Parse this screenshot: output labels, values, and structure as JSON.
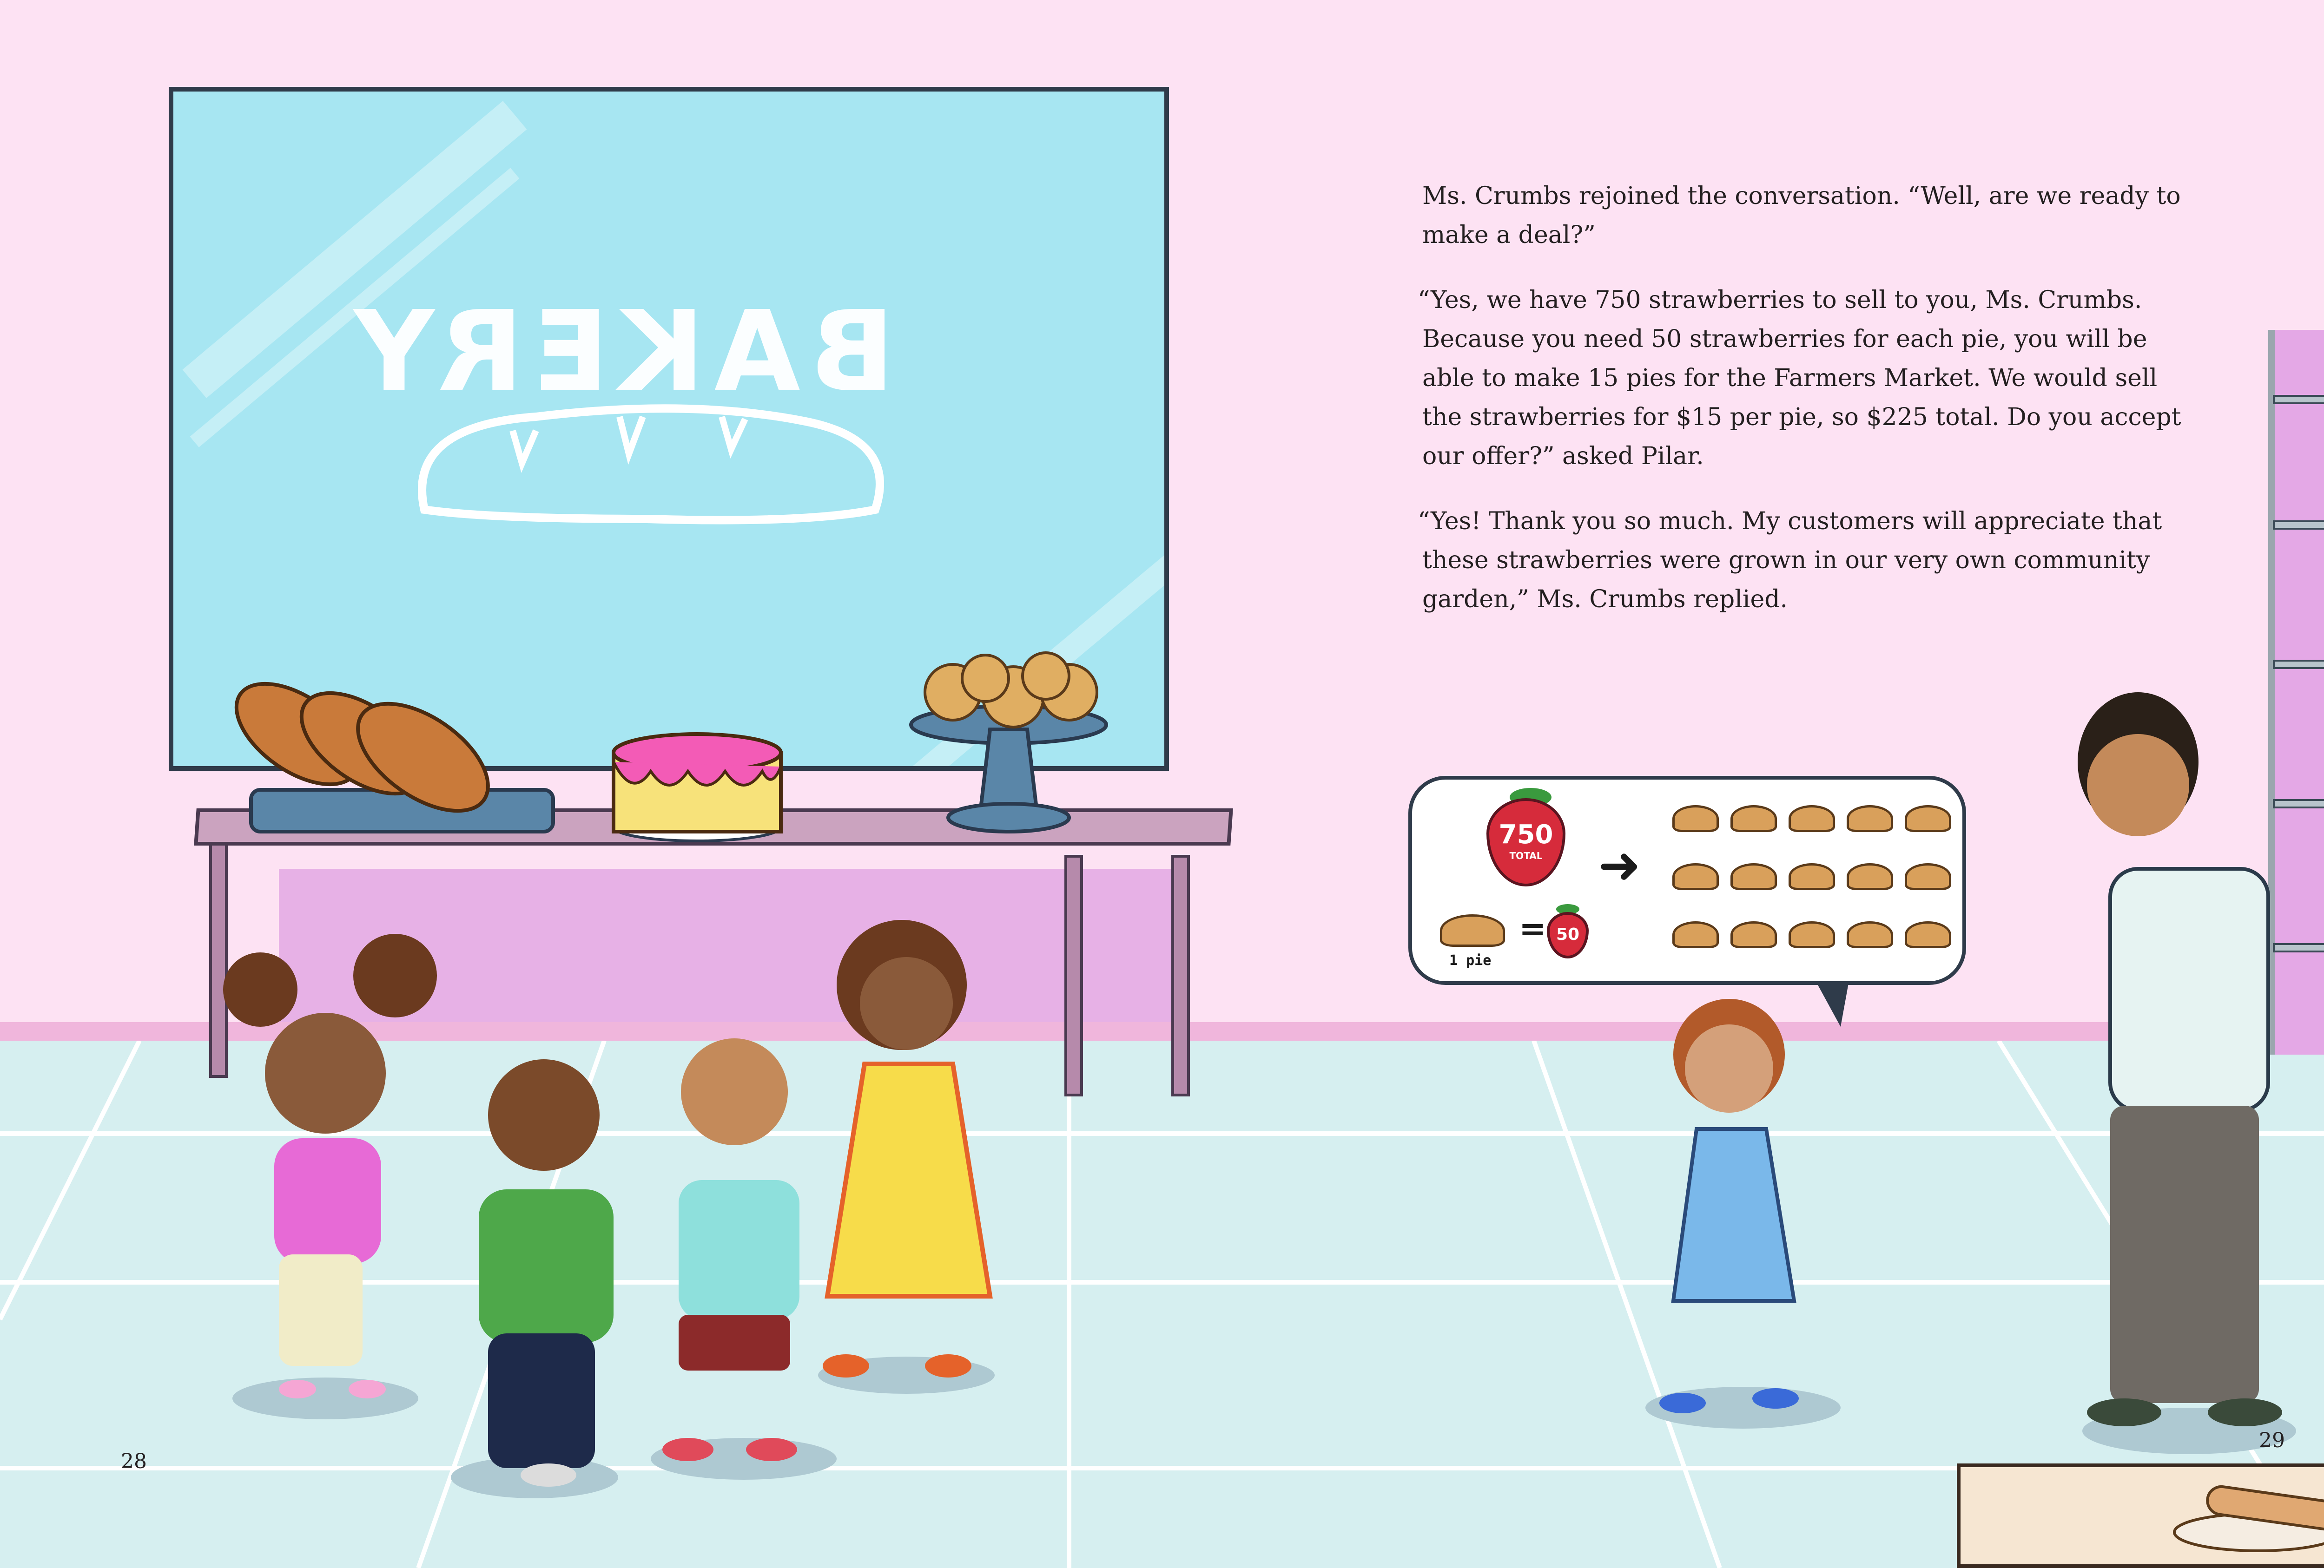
{
  "window_sign": {
    "text": "BAKERY"
  },
  "text_paragraphs": [
    {
      "lines": [
        "Ms. Crumbs rejoined the conversation. “Well, are we ready to",
        "make a deal?”"
      ]
    },
    {
      "lines": [
        "“Yes, we have 750 strawberries to sell to you, Ms. Crumbs.",
        "Because you need 50 strawberries for each pie, you will be",
        "able to make 15 pies for the Farmers Market. We would sell",
        "the strawberries for $15 per pie, so $225 total. Do you accept",
        "our offer?” asked Pilar."
      ]
    },
    {
      "lines": [
        "“Yes! Thank you so much. My customers will appreciate that",
        "these strawberries were grown in our very own community",
        "garden,” Ms. Crumbs replied."
      ]
    }
  ],
  "bubble": {
    "total_value": "750",
    "total_label": "TOTAL",
    "per_pie_value": "50",
    "equals": "=",
    "one_pie_label": "1 pie",
    "pie_count": 15
  },
  "page_numbers": {
    "left": "28",
    "right": "29"
  },
  "colors": {
    "wall": "#fde2f3",
    "floor": "#d6eff0",
    "window": "#a7e6f2",
    "strawberry": "#d62b3b"
  }
}
